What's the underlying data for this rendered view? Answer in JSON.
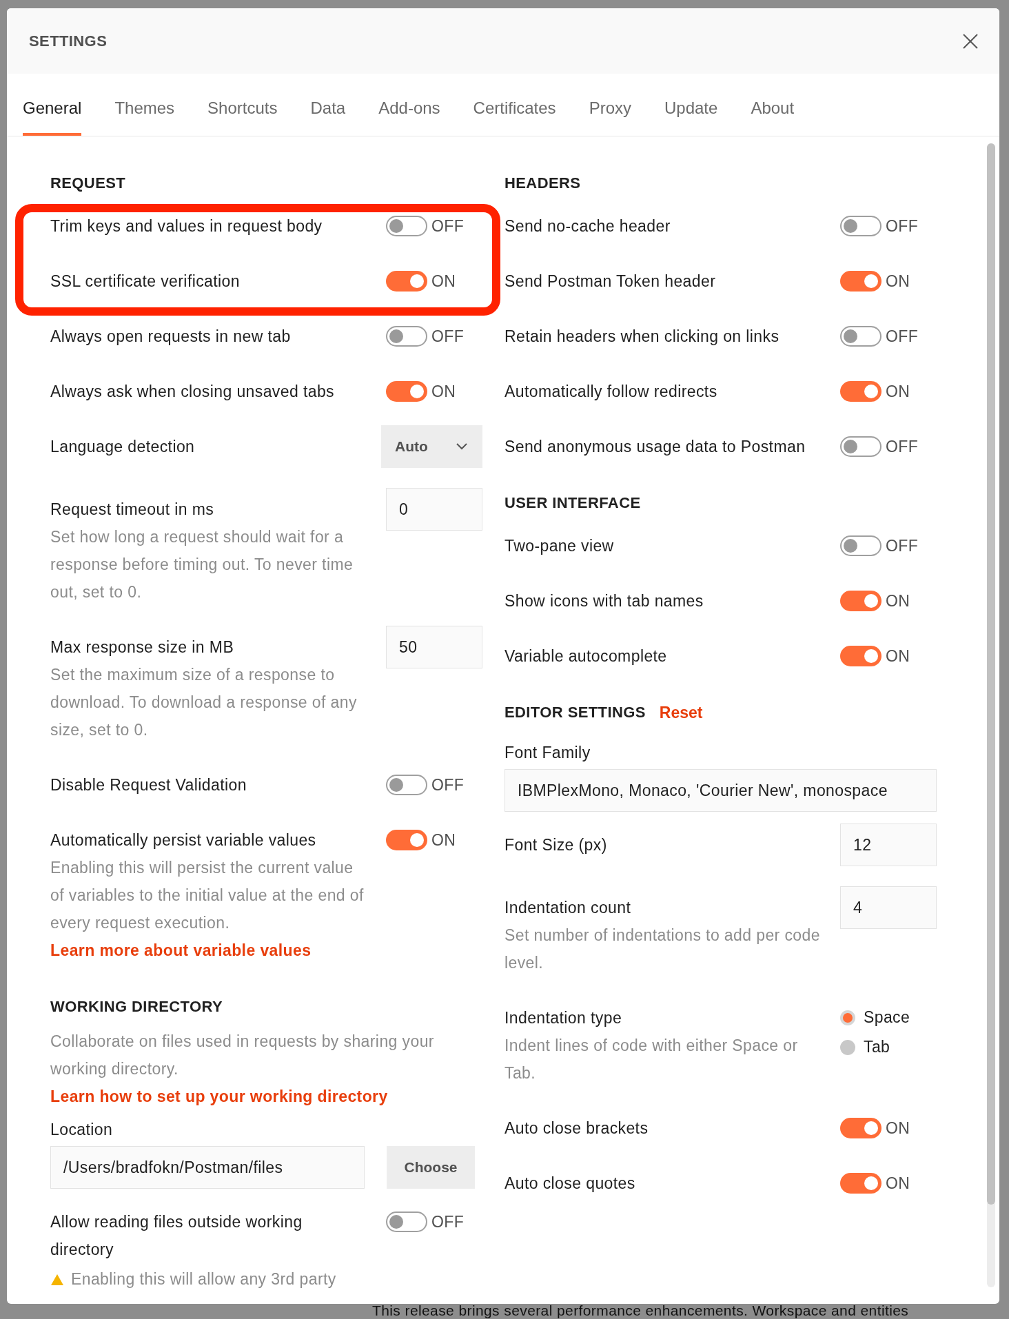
{
  "window": {
    "title": "SETTINGS"
  },
  "tabs": [
    {
      "label": "General",
      "selected": true
    },
    {
      "label": "Themes",
      "selected": false
    },
    {
      "label": "Shortcuts",
      "selected": false
    },
    {
      "label": "Data",
      "selected": false
    },
    {
      "label": "Add-ons",
      "selected": false
    },
    {
      "label": "Certificates",
      "selected": false
    },
    {
      "label": "Proxy",
      "selected": false
    },
    {
      "label": "Update",
      "selected": false
    },
    {
      "label": "About",
      "selected": false
    }
  ],
  "columns": [
    {
      "sections": [
        {
          "heading": "REQUEST",
          "items": [
            {
              "kind": "toggle",
              "label": "Trim keys and values in request body",
              "on": false,
              "state_text": "OFF"
            },
            {
              "kind": "toggle",
              "label": "SSL certificate verification",
              "on": true,
              "state_text": "ON"
            },
            {
              "kind": "toggle",
              "label": "Always open requests in new tab",
              "on": false,
              "state_text": "OFF"
            },
            {
              "kind": "toggle",
              "label": "Always ask when closing unsaved tabs",
              "on": true,
              "state_text": "ON"
            },
            {
              "kind": "select",
              "label": "Language detection",
              "value": "Auto"
            },
            {
              "kind": "input",
              "label": "Request timeout in ms",
              "value": "0",
              "description": "Set how long a request should wait for a response before timing out. To never time out, set to 0."
            },
            {
              "kind": "input",
              "label": "Max response size in MB",
              "value": "50",
              "description": "Set the maximum size of a response to download. To download a response of any size, set to 0."
            },
            {
              "kind": "toggle",
              "label": "Disable Request Validation",
              "on": false,
              "state_text": "OFF"
            },
            {
              "kind": "toggle",
              "label": "Automatically persist variable values",
              "on": true,
              "state_text": "ON",
              "description": "Enabling this will persist the current value of variables to the initial value at the end of every request execution.",
              "link": "Learn more about variable values"
            }
          ]
        },
        {
          "heading": "WORKING DIRECTORY",
          "description": "Collaborate on files used in requests by sharing your working directory.",
          "link": "Learn how to set up your working directory",
          "items": [
            {
              "kind": "location",
              "label": "Location",
              "value": "/Users/bradfokn/Postman/files",
              "button": "Choose"
            },
            {
              "kind": "toggle",
              "label": "Allow reading files outside working directory",
              "on": false,
              "state_text": "OFF",
              "warning": "Enabling this will allow any 3rd party"
            }
          ]
        }
      ]
    },
    {
      "sections": [
        {
          "heading": "HEADERS",
          "items": [
            {
              "kind": "toggle",
              "label": "Send no-cache header",
              "on": false,
              "state_text": "OFF"
            },
            {
              "kind": "toggle",
              "label": "Send Postman Token header",
              "on": true,
              "state_text": "ON"
            },
            {
              "kind": "toggle",
              "label": "Retain headers when clicking on links",
              "on": false,
              "state_text": "OFF"
            },
            {
              "kind": "toggle",
              "label": "Automatically follow redirects",
              "on": true,
              "state_text": "ON"
            },
            {
              "kind": "toggle",
              "label": "Send anonymous usage data to Postman",
              "on": false,
              "state_text": "OFF"
            }
          ]
        },
        {
          "heading": "USER INTERFACE",
          "items": [
            {
              "kind": "toggle",
              "label": "Two-pane view",
              "on": false,
              "state_text": "OFF"
            },
            {
              "kind": "toggle",
              "label": "Show icons with tab names",
              "on": true,
              "state_text": "ON"
            },
            {
              "kind": "toggle",
              "label": "Variable autocomplete",
              "on": true,
              "state_text": "ON"
            }
          ]
        },
        {
          "heading": "EDITOR SETTINGS",
          "action": "Reset",
          "items": [
            {
              "kind": "wide_input",
              "label": "Font Family",
              "value": "IBMPlexMono, Monaco, 'Courier New', monospace"
            },
            {
              "kind": "input",
              "label": "Font Size (px)",
              "value": "12"
            },
            {
              "kind": "input",
              "label": "Indentation count",
              "value": "4",
              "description": "Set number of indentations to add per code level."
            },
            {
              "kind": "radio",
              "label": "Indentation type",
              "description": "Indent lines of code with either Space or Tab.",
              "options": [
                {
                  "label": "Space",
                  "selected": true
                },
                {
                  "label": "Tab",
                  "selected": false
                }
              ]
            },
            {
              "kind": "toggle",
              "label": "Auto close brackets",
              "on": true,
              "state_text": "ON"
            },
            {
              "kind": "toggle",
              "label": "Auto close quotes",
              "on": true,
              "state_text": "ON"
            }
          ]
        }
      ]
    }
  ],
  "background_text": "This release brings several performance enhancements. Workspace and entities"
}
